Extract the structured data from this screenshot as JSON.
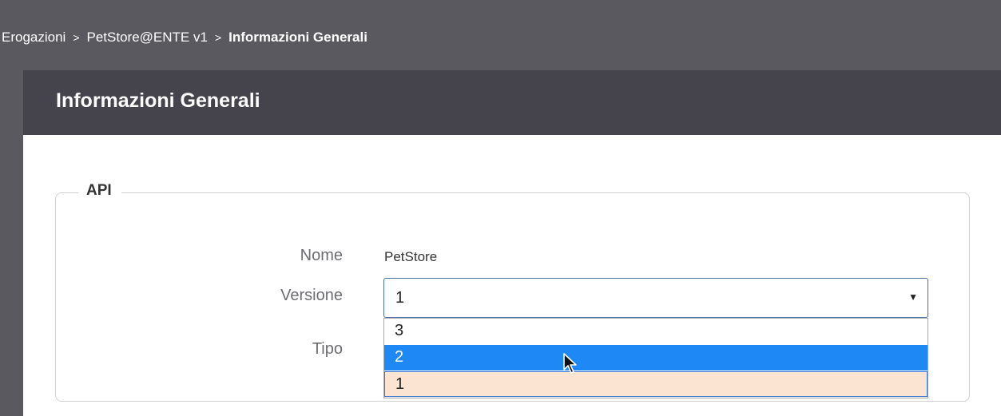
{
  "breadcrumb": {
    "items": [
      "Erogazioni",
      "PetStore@ENTE v1"
    ],
    "separator": ">",
    "current": "Informazioni Generali"
  },
  "panel": {
    "title": "Informazioni Generali"
  },
  "fieldset": {
    "legend": "API",
    "fields": {
      "nome_label": "Nome",
      "nome_value": "PetStore",
      "versione_label": "Versione",
      "tipo_label": "Tipo"
    }
  },
  "select": {
    "value": "1",
    "arrow": "▼",
    "options": [
      "3",
      "2",
      "1"
    ],
    "hovered": "2"
  },
  "colors": {
    "background": "#5a5960",
    "header": "#45444c",
    "hover": "#1e88f5",
    "selected": "#fce4d2"
  },
  "icons": {
    "cursor": "mouse-pointer-icon",
    "dropdown": "caret-down-icon"
  }
}
